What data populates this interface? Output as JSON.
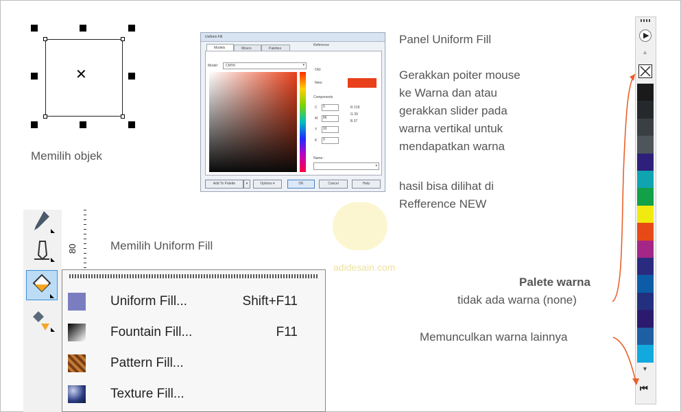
{
  "selection": {
    "caption": "Memilih objek"
  },
  "dialog": {
    "title": "Uniform Fill",
    "tabs": [
      "Models",
      "Mixers",
      "Palettes"
    ],
    "model_label": "Model:",
    "model_value": "CMYK",
    "reference_label": "Reference",
    "old_label": "Old:",
    "new_label": "New:",
    "components_label": "Components",
    "components": [
      {
        "key": "C",
        "value": "0"
      },
      {
        "key": "M",
        "value": "86"
      },
      {
        "key": "Y",
        "value": "93"
      },
      {
        "key": "K",
        "value": "0"
      }
    ],
    "rgb": [
      {
        "key": "R",
        "value": "218"
      },
      {
        "key": "G",
        "value": "39"
      },
      {
        "key": "B",
        "value": "37"
      }
    ],
    "name_label": "Name:",
    "buttons": {
      "add_to_palette": "Add To Palette",
      "options": "Options",
      "ok": "OK",
      "cancel": "Cancel",
      "help": "Help"
    },
    "colors": {
      "new_color": "#e8401a"
    }
  },
  "notes": {
    "panel_title": "Panel Uniform Fill",
    "instructions": [
      "Gerakkan poiter mouse",
      "ke Warna dan atau",
      "gerakkan slider pada",
      "warna vertikal untuk",
      "mendapatkan warna"
    ],
    "result": [
      "hasil bisa dilihat di",
      "Refference NEW"
    ]
  },
  "watermark": {
    "text": "adidesain.com"
  },
  "toolbar": {
    "ruler_label": "80",
    "fill_caption": "Memilih Uniform Fill"
  },
  "flyout": {
    "items": [
      {
        "label": "Uniform Fill...",
        "shortcut": "Shift+F11",
        "icon": "uniform-fill-icon"
      },
      {
        "label": "Fountain Fill...",
        "shortcut": "F11",
        "icon": "fountain-fill-icon"
      },
      {
        "label": "Pattern Fill...",
        "shortcut": "",
        "icon": "pattern-fill-icon"
      },
      {
        "label": "Texture Fill...",
        "shortcut": "",
        "icon": "texture-fill-icon"
      }
    ]
  },
  "palette": {
    "annotation_title": "Palete warna",
    "annotation_none": "tidak ada warna (none)",
    "annotation_more": "Memunculkan warna lainnya",
    "colors": [
      "#1a1a1a",
      "#26292b",
      "#3a3f44",
      "#4e555b",
      "#2e1f7a",
      "#0fa4b0",
      "#12a048",
      "#f1ea10",
      "#e84a17",
      "#a42686",
      "#2a2b7e",
      "#0c5ca8",
      "#23307f",
      "#2b1a6e",
      "#1e5fa3",
      "#12a9df"
    ]
  }
}
